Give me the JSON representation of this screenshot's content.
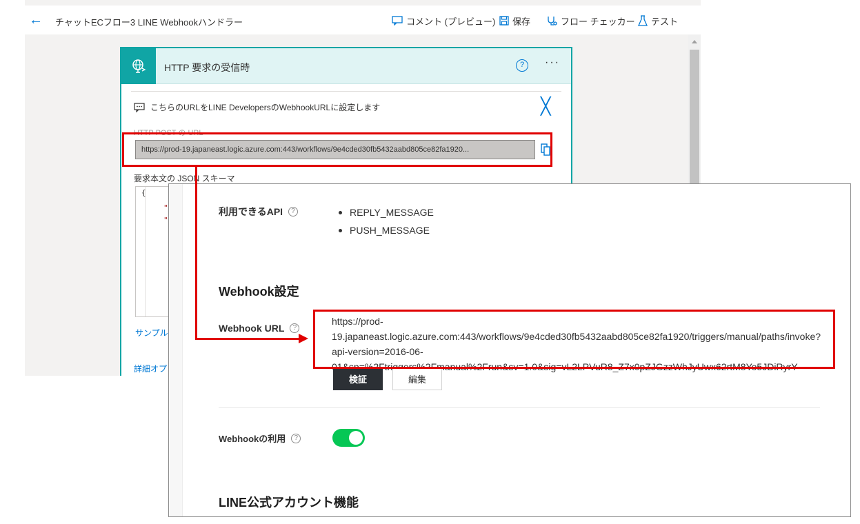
{
  "topbar": {
    "flow_title": "チャットECフロー3 LINE Webhookハンドラー",
    "comment_label": "コメント (プレビュー)",
    "save_label": "保存",
    "checker_label": "フロー チェッカー",
    "test_label": "テスト"
  },
  "trigger_card": {
    "title": "HTTP 要求の受信時",
    "help": "?",
    "more": "···",
    "info_text": "こちらのURLをLINE DevelopersのWebhookURLに設定します",
    "close": "╳",
    "post_url_label": "HTTP POST の URL",
    "post_url_value": "https://prod-19.japaneast.logic.azure.com:443/workflows/9e4cded30fb5432aabd805ce82fa1920...",
    "schema_label": "要求本文の JSON スキーマ",
    "schema_open_brace": "{",
    "schema_quote": "\"",
    "sample_link": "サンプル",
    "advanced_link": "詳細オプ"
  },
  "line_settings": {
    "api_label": "利用できるAPI",
    "api_items": [
      "REPLY_MESSAGE",
      "PUSH_MESSAGE"
    ],
    "webhook_section": "Webhook設定",
    "webhook_url_label": "Webhook URL",
    "webhook_url_value": "https://prod-19.japaneast.logic.azure.com:443/workflows/9e4cded30fb5432aabd805ce82fa1920/triggers/manual/paths/invoke?api-version=2016-06-01&sp=%2Ftriggers%2Fmanual%2Frun&sv=1.0&sig=vL2LPVuR8_Z7x0pZJGzzWhJyUwx62rtM8Yo5JDiRyrY",
    "verify_button": "検証",
    "edit_button": "編集",
    "use_webhook_label": "Webhookの利用",
    "use_webhook_enabled": true,
    "oa_section": "LINE公式アカウント機能",
    "help": "?"
  },
  "colors": {
    "accent_blue": "#0078d4",
    "trigger_teal": "#10a5a5",
    "line_green": "#06c755",
    "annotation_red": "#e00000"
  }
}
